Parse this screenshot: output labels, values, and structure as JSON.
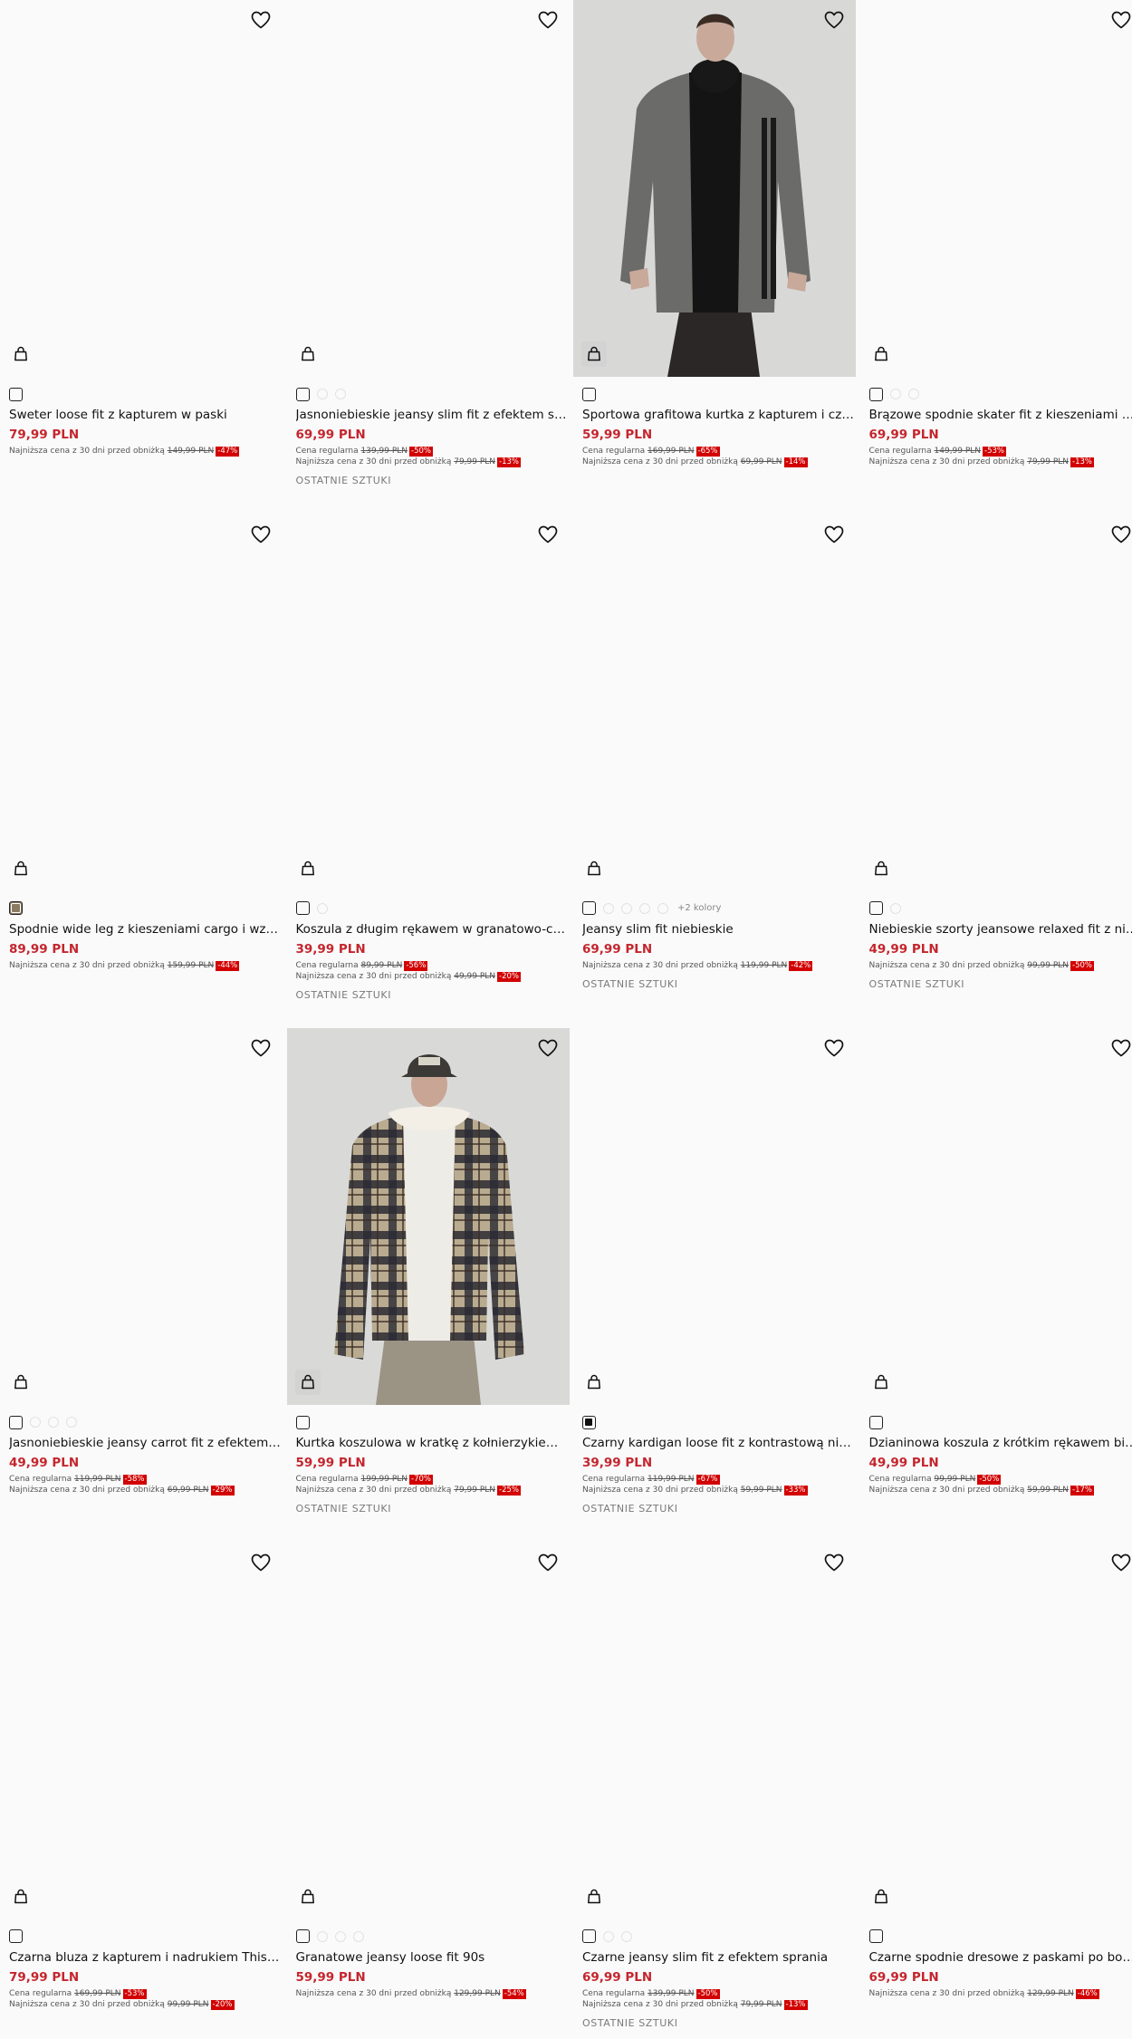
{
  "labels": {
    "regular": "Cena regularna",
    "lowest": "Najniższa cena z 30 dni przed obniżką",
    "last_items": "OSTATNIE SZTUKI"
  },
  "products": [
    {
      "name": "Sweter loose fit z kapturem w paski",
      "price": "79,99 PLN",
      "regular": null,
      "lowest": {
        "old": "149,99 PLN",
        "disc": "-47%"
      },
      "last": false,
      "swatch": "outline",
      "extra": 0,
      "image": "none"
    },
    {
      "name": "Jasnoniebieskie jeansy slim fit z efektem sprania",
      "price": "69,99 PLN",
      "regular": {
        "old": "139,99 PLN",
        "disc": "-50%"
      },
      "lowest": {
        "old": "79,99 PLN",
        "disc": "-13%"
      },
      "last": true,
      "swatch": "outline",
      "extra": 2,
      "image": "none"
    },
    {
      "name": "Sportowa grafitowa kurtka z kapturem i czarnymi paskami",
      "price": "59,99 PLN",
      "regular": {
        "old": "169,99 PLN",
        "disc": "-65%"
      },
      "lowest": {
        "old": "69,99 PLN",
        "disc": "-14%"
      },
      "last": false,
      "swatch": "outline",
      "extra": 0,
      "image": "jacket"
    },
    {
      "name": "Brązowe spodnie skater fit z kieszeniami cargo",
      "price": "69,99 PLN",
      "regular": {
        "old": "149,99 PLN",
        "disc": "-53%"
      },
      "lowest": {
        "old": "79,99 PLN",
        "disc": "-13%"
      },
      "last": false,
      "swatch": "outline",
      "extra": 2,
      "image": "none"
    },
    {
      "name": "Spodnie wide leg z kieszeniami cargo i wzorem moro",
      "price": "89,99 PLN",
      "regular": null,
      "lowest": {
        "old": "159,99 PLN",
        "disc": "-44%"
      },
      "last": false,
      "swatch": "brown",
      "extra": 0,
      "image": "none"
    },
    {
      "name": "Koszula z długim rękawem w granatowo-czarną kratę",
      "price": "39,99 PLN",
      "regular": {
        "old": "89,99 PLN",
        "disc": "-56%"
      },
      "lowest": {
        "old": "49,99 PLN",
        "disc": "-20%"
      },
      "last": true,
      "swatch": "outline",
      "extra": 1,
      "image": "none"
    },
    {
      "name": "Jeansy slim fit niebieskie",
      "price": "69,99 PLN",
      "regular": null,
      "lowest": {
        "old": "119,99 PLN",
        "disc": "-42%"
      },
      "last": true,
      "swatch": "outline",
      "extra": 4,
      "more": "+2 kolory",
      "image": "none"
    },
    {
      "name": "Niebieskie szorty jeansowe relaxed fit z niskim stanem",
      "price": "49,99 PLN",
      "regular": null,
      "lowest": {
        "old": "99,99 PLN",
        "disc": "-50%"
      },
      "last": true,
      "swatch": "outline",
      "extra": 1,
      "image": "none"
    },
    {
      "name": "Jasnoniebieskie jeansy carrot fit z efektem sprania",
      "price": "49,99 PLN",
      "regular": {
        "old": "119,99 PLN",
        "disc": "-58%"
      },
      "lowest": {
        "old": "69,99 PLN",
        "disc": "-29%"
      },
      "last": false,
      "swatch": "outline",
      "extra": 3,
      "image": "none"
    },
    {
      "name": "Kurtka koszulowa w kratkę z kołnierzykiem sherpa",
      "price": "59,99 PLN",
      "regular": {
        "old": "199,99 PLN",
        "disc": "-70%"
      },
      "lowest": {
        "old": "79,99 PLN",
        "disc": "-25%"
      },
      "last": true,
      "swatch": "outline",
      "extra": 0,
      "image": "plaid"
    },
    {
      "name": "Czarny kardigan loose fit z kontrastową nitką",
      "price": "39,99 PLN",
      "regular": {
        "old": "119,99 PLN",
        "disc": "-67%"
      },
      "lowest": {
        "old": "59,99 PLN",
        "disc": "-33%"
      },
      "last": true,
      "swatch": "black",
      "extra": 0,
      "image": "none"
    },
    {
      "name": "Dzianinowa koszula z krótkim rękawem biała",
      "price": "49,99 PLN",
      "regular": {
        "old": "99,99 PLN",
        "disc": "-50%"
      },
      "lowest": {
        "old": "59,99 PLN",
        "disc": "-17%"
      },
      "last": false,
      "swatch": "outline",
      "extra": 0,
      "image": "none"
    },
    {
      "name": "Czarna bluza z kapturem i nadrukiem This Artist",
      "price": "79,99 PLN",
      "regular": {
        "old": "169,99 PLN",
        "disc": "-53%"
      },
      "lowest": {
        "old": "99,99 PLN",
        "disc": "-20%"
      },
      "last": false,
      "swatch": "outline",
      "extra": 0,
      "image": "none"
    },
    {
      "name": "Granatowe jeansy loose fit 90s",
      "price": "59,99 PLN",
      "regular": null,
      "lowest": {
        "old": "129,99 PLN",
        "disc": "-54%"
      },
      "last": false,
      "swatch": "outline",
      "extra": 3,
      "image": "none"
    },
    {
      "name": "Czarne jeansy slim fit z efektem sprania",
      "price": "69,99 PLN",
      "regular": {
        "old": "139,99 PLN",
        "disc": "-50%"
      },
      "lowest": {
        "old": "79,99 PLN",
        "disc": "-13%"
      },
      "last": true,
      "swatch": "outline",
      "extra": 2,
      "image": "none"
    },
    {
      "name": "Czarne spodnie dresowe z paskami po bokach",
      "price": "69,99 PLN",
      "regular": null,
      "lowest": {
        "old": "129,99 PLN",
        "disc": "-46%"
      },
      "last": false,
      "swatch": "outline",
      "extra": 0,
      "image": "none"
    }
  ],
  "colors": {
    "price": "#c4262e",
    "discount": "#d20000",
    "background": "#fafafa"
  },
  "icons": {
    "favorite": "heart-icon",
    "cart": "shopping-bag-icon"
  }
}
